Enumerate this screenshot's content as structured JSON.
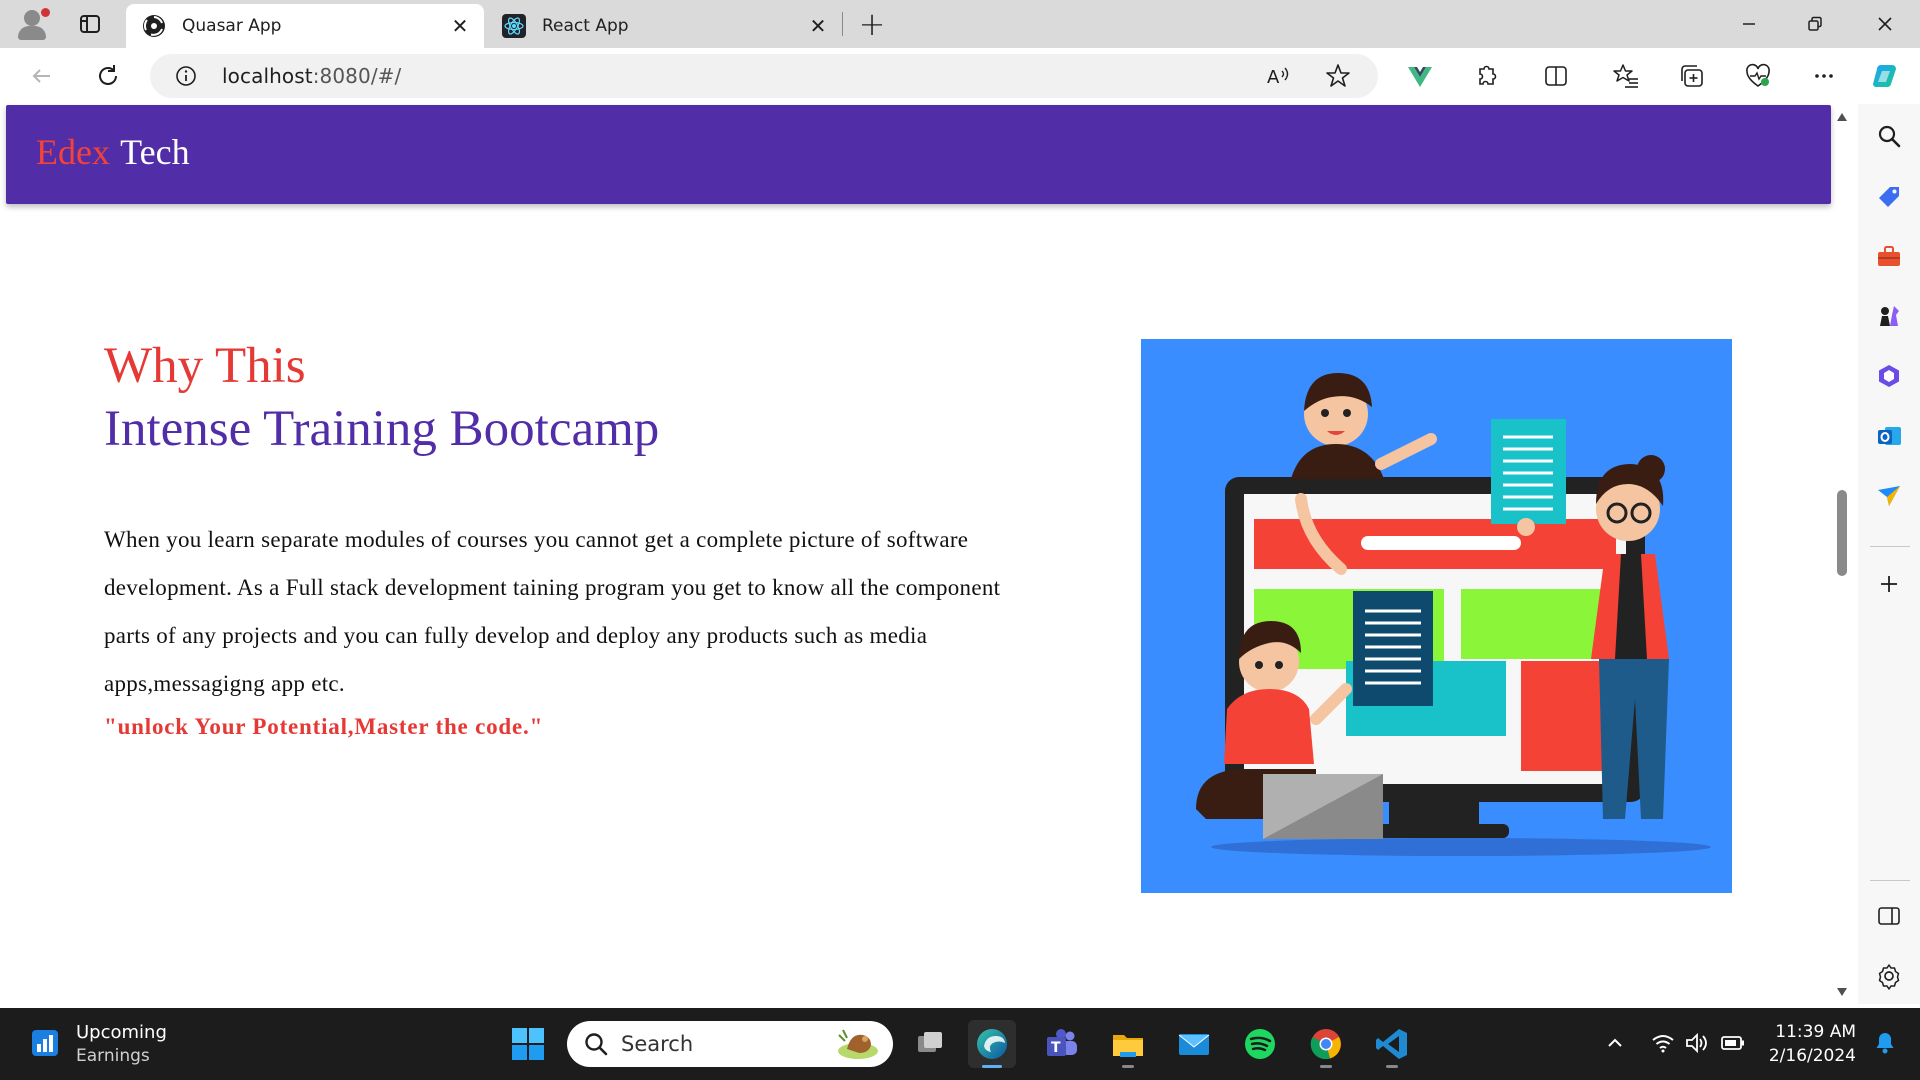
{
  "browser": {
    "tabs": [
      {
        "label": "Quasar App",
        "active": true,
        "icon": "quasar-logo-icon"
      },
      {
        "label": "React App",
        "active": false,
        "icon": "react-logo-icon"
      }
    ],
    "address": {
      "host": "localhost",
      "rest": ":8080/#/"
    },
    "colors": {
      "titlebar": "#dadada",
      "toolbar": "#ffffff"
    }
  },
  "page": {
    "brand": {
      "part1": "Edex",
      "part2": "Tech"
    },
    "heading": {
      "line1": "Why This",
      "line2": "Intense Training Bootcamp"
    },
    "body": "When you learn separate modules of courses you cannot get a complete picture of software development. As a Full stack development taining program you get to know all the component parts of any projects and you can fully develop and deploy any products such as media apps,messagigng app etc.",
    "tagline": "\"unlock Your Potential,Master the code.\"",
    "colors": {
      "header": "#512da8",
      "accent_red": "#e53935",
      "accent_purple": "#512da8",
      "illustration_bg": "#3a8dff"
    }
  },
  "sidebar": {
    "icons": [
      "search-icon",
      "tag-icon",
      "toolbox-icon",
      "chess-icon",
      "office-icon",
      "outlook-icon",
      "send-icon",
      "add-icon",
      "split-icon",
      "settings-icon"
    ]
  },
  "taskbar": {
    "weather": {
      "line1": "Upcoming",
      "line2": "Earnings"
    },
    "search_placeholder": "Search",
    "clock": {
      "time": "11:39 AM",
      "date": "2/16/2024"
    }
  }
}
